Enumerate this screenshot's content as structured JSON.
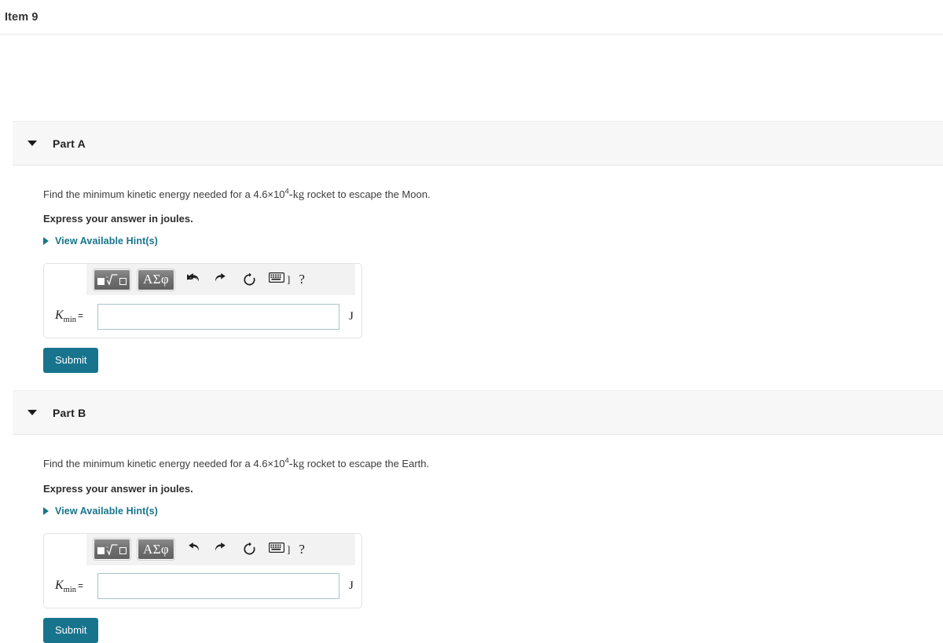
{
  "header": {
    "item_title": "Item 9"
  },
  "toolbar": {
    "template_button_label": "math-template",
    "greek_button_label": "ΑΣφ",
    "undo_label": "undo",
    "redo_label": "redo",
    "reset_label": "reset",
    "keyboard_label": "keyboard-shortcuts",
    "keyboard_bracket": "]",
    "help_label": "?"
  },
  "parts": [
    {
      "id": "part-a",
      "label": "Part A",
      "question_prefix": "Find the minimum kinetic energy needed for a ",
      "question_value": "4.6×10",
      "question_exponent": "4",
      "question_unit": "-kg",
      "question_suffix": " rocket to escape the Moon.",
      "instruction": "Express your answer in joules.",
      "hints_label": "View Available Hint(s)",
      "variable": "K",
      "variable_sub": "min",
      "equals": "=",
      "input_value": "",
      "unit": "J",
      "submit_label": "Submit"
    },
    {
      "id": "part-b",
      "label": "Part B",
      "question_prefix": "Find the minimum kinetic energy needed for a ",
      "question_value": "4.6×10",
      "question_exponent": "4",
      "question_unit": "-kg",
      "question_suffix": " rocket to escape the Earth.",
      "instruction": "Express your answer in joules.",
      "hints_label": "View Available Hint(s)",
      "variable": "K",
      "variable_sub": "min",
      "equals": "=",
      "input_value": "",
      "unit": "J",
      "submit_label": "Submit"
    }
  ],
  "colors": {
    "accent": "#17748c",
    "band_background": "#f7f7f7",
    "input_border": "#a9c4c9",
    "text": "#333333"
  }
}
